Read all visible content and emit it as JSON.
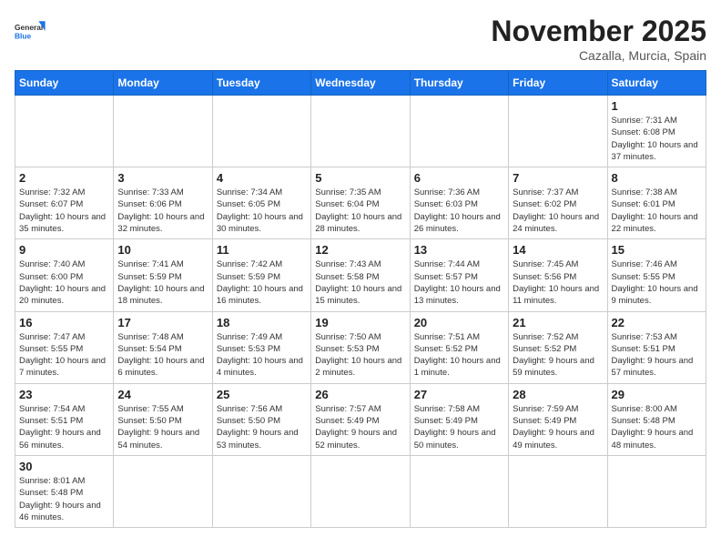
{
  "header": {
    "logo_general": "General",
    "logo_blue": "Blue",
    "month_title": "November 2025",
    "location": "Cazalla, Murcia, Spain"
  },
  "weekdays": [
    "Sunday",
    "Monday",
    "Tuesday",
    "Wednesday",
    "Thursday",
    "Friday",
    "Saturday"
  ],
  "days": {
    "d1": {
      "num": "1",
      "sunrise": "7:31 AM",
      "sunset": "6:08 PM",
      "daylight": "10 hours and 37 minutes."
    },
    "d2": {
      "num": "2",
      "sunrise": "7:32 AM",
      "sunset": "6:07 PM",
      "daylight": "10 hours and 35 minutes."
    },
    "d3": {
      "num": "3",
      "sunrise": "7:33 AM",
      "sunset": "6:06 PM",
      "daylight": "10 hours and 32 minutes."
    },
    "d4": {
      "num": "4",
      "sunrise": "7:34 AM",
      "sunset": "6:05 PM",
      "daylight": "10 hours and 30 minutes."
    },
    "d5": {
      "num": "5",
      "sunrise": "7:35 AM",
      "sunset": "6:04 PM",
      "daylight": "10 hours and 28 minutes."
    },
    "d6": {
      "num": "6",
      "sunrise": "7:36 AM",
      "sunset": "6:03 PM",
      "daylight": "10 hours and 26 minutes."
    },
    "d7": {
      "num": "7",
      "sunrise": "7:37 AM",
      "sunset": "6:02 PM",
      "daylight": "10 hours and 24 minutes."
    },
    "d8": {
      "num": "8",
      "sunrise": "7:38 AM",
      "sunset": "6:01 PM",
      "daylight": "10 hours and 22 minutes."
    },
    "d9": {
      "num": "9",
      "sunrise": "7:40 AM",
      "sunset": "6:00 PM",
      "daylight": "10 hours and 20 minutes."
    },
    "d10": {
      "num": "10",
      "sunrise": "7:41 AM",
      "sunset": "5:59 PM",
      "daylight": "10 hours and 18 minutes."
    },
    "d11": {
      "num": "11",
      "sunrise": "7:42 AM",
      "sunset": "5:59 PM",
      "daylight": "10 hours and 16 minutes."
    },
    "d12": {
      "num": "12",
      "sunrise": "7:43 AM",
      "sunset": "5:58 PM",
      "daylight": "10 hours and 15 minutes."
    },
    "d13": {
      "num": "13",
      "sunrise": "7:44 AM",
      "sunset": "5:57 PM",
      "daylight": "10 hours and 13 minutes."
    },
    "d14": {
      "num": "14",
      "sunrise": "7:45 AM",
      "sunset": "5:56 PM",
      "daylight": "10 hours and 11 minutes."
    },
    "d15": {
      "num": "15",
      "sunrise": "7:46 AM",
      "sunset": "5:55 PM",
      "daylight": "10 hours and 9 minutes."
    },
    "d16": {
      "num": "16",
      "sunrise": "7:47 AM",
      "sunset": "5:55 PM",
      "daylight": "10 hours and 7 minutes."
    },
    "d17": {
      "num": "17",
      "sunrise": "7:48 AM",
      "sunset": "5:54 PM",
      "daylight": "10 hours and 6 minutes."
    },
    "d18": {
      "num": "18",
      "sunrise": "7:49 AM",
      "sunset": "5:53 PM",
      "daylight": "10 hours and 4 minutes."
    },
    "d19": {
      "num": "19",
      "sunrise": "7:50 AM",
      "sunset": "5:53 PM",
      "daylight": "10 hours and 2 minutes."
    },
    "d20": {
      "num": "20",
      "sunrise": "7:51 AM",
      "sunset": "5:52 PM",
      "daylight": "10 hours and 1 minute."
    },
    "d21": {
      "num": "21",
      "sunrise": "7:52 AM",
      "sunset": "5:52 PM",
      "daylight": "9 hours and 59 minutes."
    },
    "d22": {
      "num": "22",
      "sunrise": "7:53 AM",
      "sunset": "5:51 PM",
      "daylight": "9 hours and 57 minutes."
    },
    "d23": {
      "num": "23",
      "sunrise": "7:54 AM",
      "sunset": "5:51 PM",
      "daylight": "9 hours and 56 minutes."
    },
    "d24": {
      "num": "24",
      "sunrise": "7:55 AM",
      "sunset": "5:50 PM",
      "daylight": "9 hours and 54 minutes."
    },
    "d25": {
      "num": "25",
      "sunrise": "7:56 AM",
      "sunset": "5:50 PM",
      "daylight": "9 hours and 53 minutes."
    },
    "d26": {
      "num": "26",
      "sunrise": "7:57 AM",
      "sunset": "5:49 PM",
      "daylight": "9 hours and 52 minutes."
    },
    "d27": {
      "num": "27",
      "sunrise": "7:58 AM",
      "sunset": "5:49 PM",
      "daylight": "9 hours and 50 minutes."
    },
    "d28": {
      "num": "28",
      "sunrise": "7:59 AM",
      "sunset": "5:49 PM",
      "daylight": "9 hours and 49 minutes."
    },
    "d29": {
      "num": "29",
      "sunrise": "8:00 AM",
      "sunset": "5:48 PM",
      "daylight": "9 hours and 48 minutes."
    },
    "d30": {
      "num": "30",
      "sunrise": "8:01 AM",
      "sunset": "5:48 PM",
      "daylight": "9 hours and 46 minutes."
    }
  }
}
